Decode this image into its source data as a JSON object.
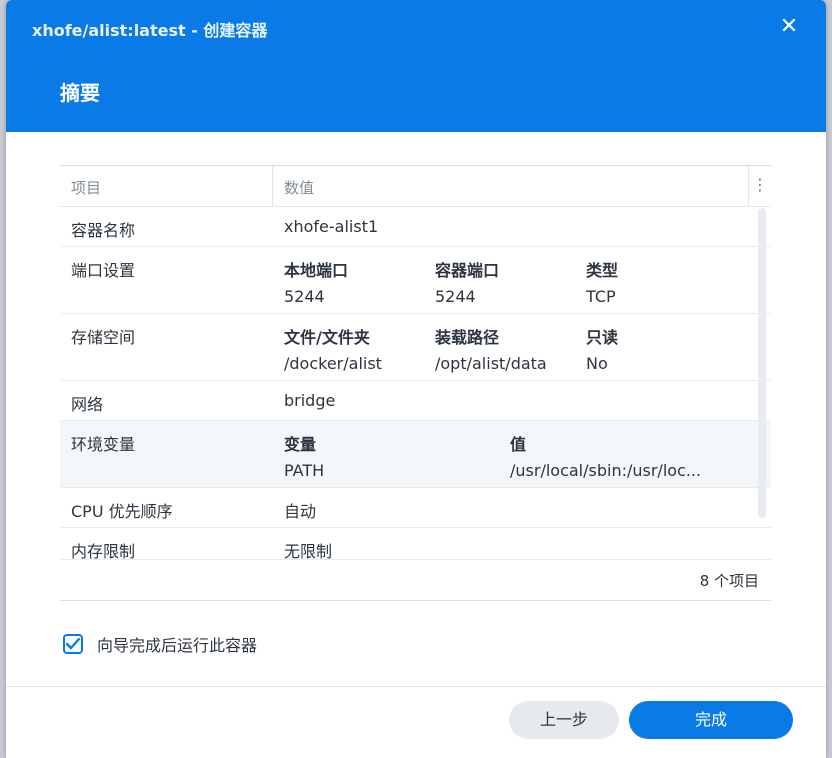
{
  "window": {
    "title": "xhofe/alist:latest - 创建容器",
    "heading": "摘要",
    "close_glyph": "✕"
  },
  "table": {
    "col_item": "项目",
    "col_value": "数值",
    "more_glyph": "⋮",
    "rows": [
      {
        "label": "容器名称",
        "value": "xhofe-alist1"
      },
      {
        "label": "端口设置",
        "sub": [
          {
            "h": "本地端口",
            "v": "5244"
          },
          {
            "h": "容器端口",
            "v": "5244"
          },
          {
            "h": "类型",
            "v": "TCP"
          }
        ]
      },
      {
        "label": "存储空间",
        "sub": [
          {
            "h": "文件/文件夹",
            "v": "/docker/alist"
          },
          {
            "h": "装载路径",
            "v": "/opt/alist/data"
          },
          {
            "h": "只读",
            "v": "No"
          }
        ]
      },
      {
        "label": "网络",
        "value": "bridge"
      },
      {
        "label": "环境变量",
        "sub": [
          {
            "h": "变量",
            "v": "PATH"
          },
          {
            "h": "值",
            "v": "/usr/local/sbin:/usr/loc..."
          }
        ]
      },
      {
        "label": "CPU 优先顺序",
        "value": "自动"
      },
      {
        "label": "内存限制",
        "value": "无限制"
      }
    ],
    "count_text": "8 个项目"
  },
  "options": {
    "run_after_wizard": {
      "label": "向导完成后运行此容器",
      "checked": true
    }
  },
  "buttons": {
    "prev": "上一步",
    "done": "完成"
  },
  "colors": {
    "accent": "#0a7be6",
    "header": "#0a7be6"
  },
  "icons": {
    "close": "close-icon",
    "more": "more-vertical-icon",
    "check": "checkmark-icon"
  }
}
